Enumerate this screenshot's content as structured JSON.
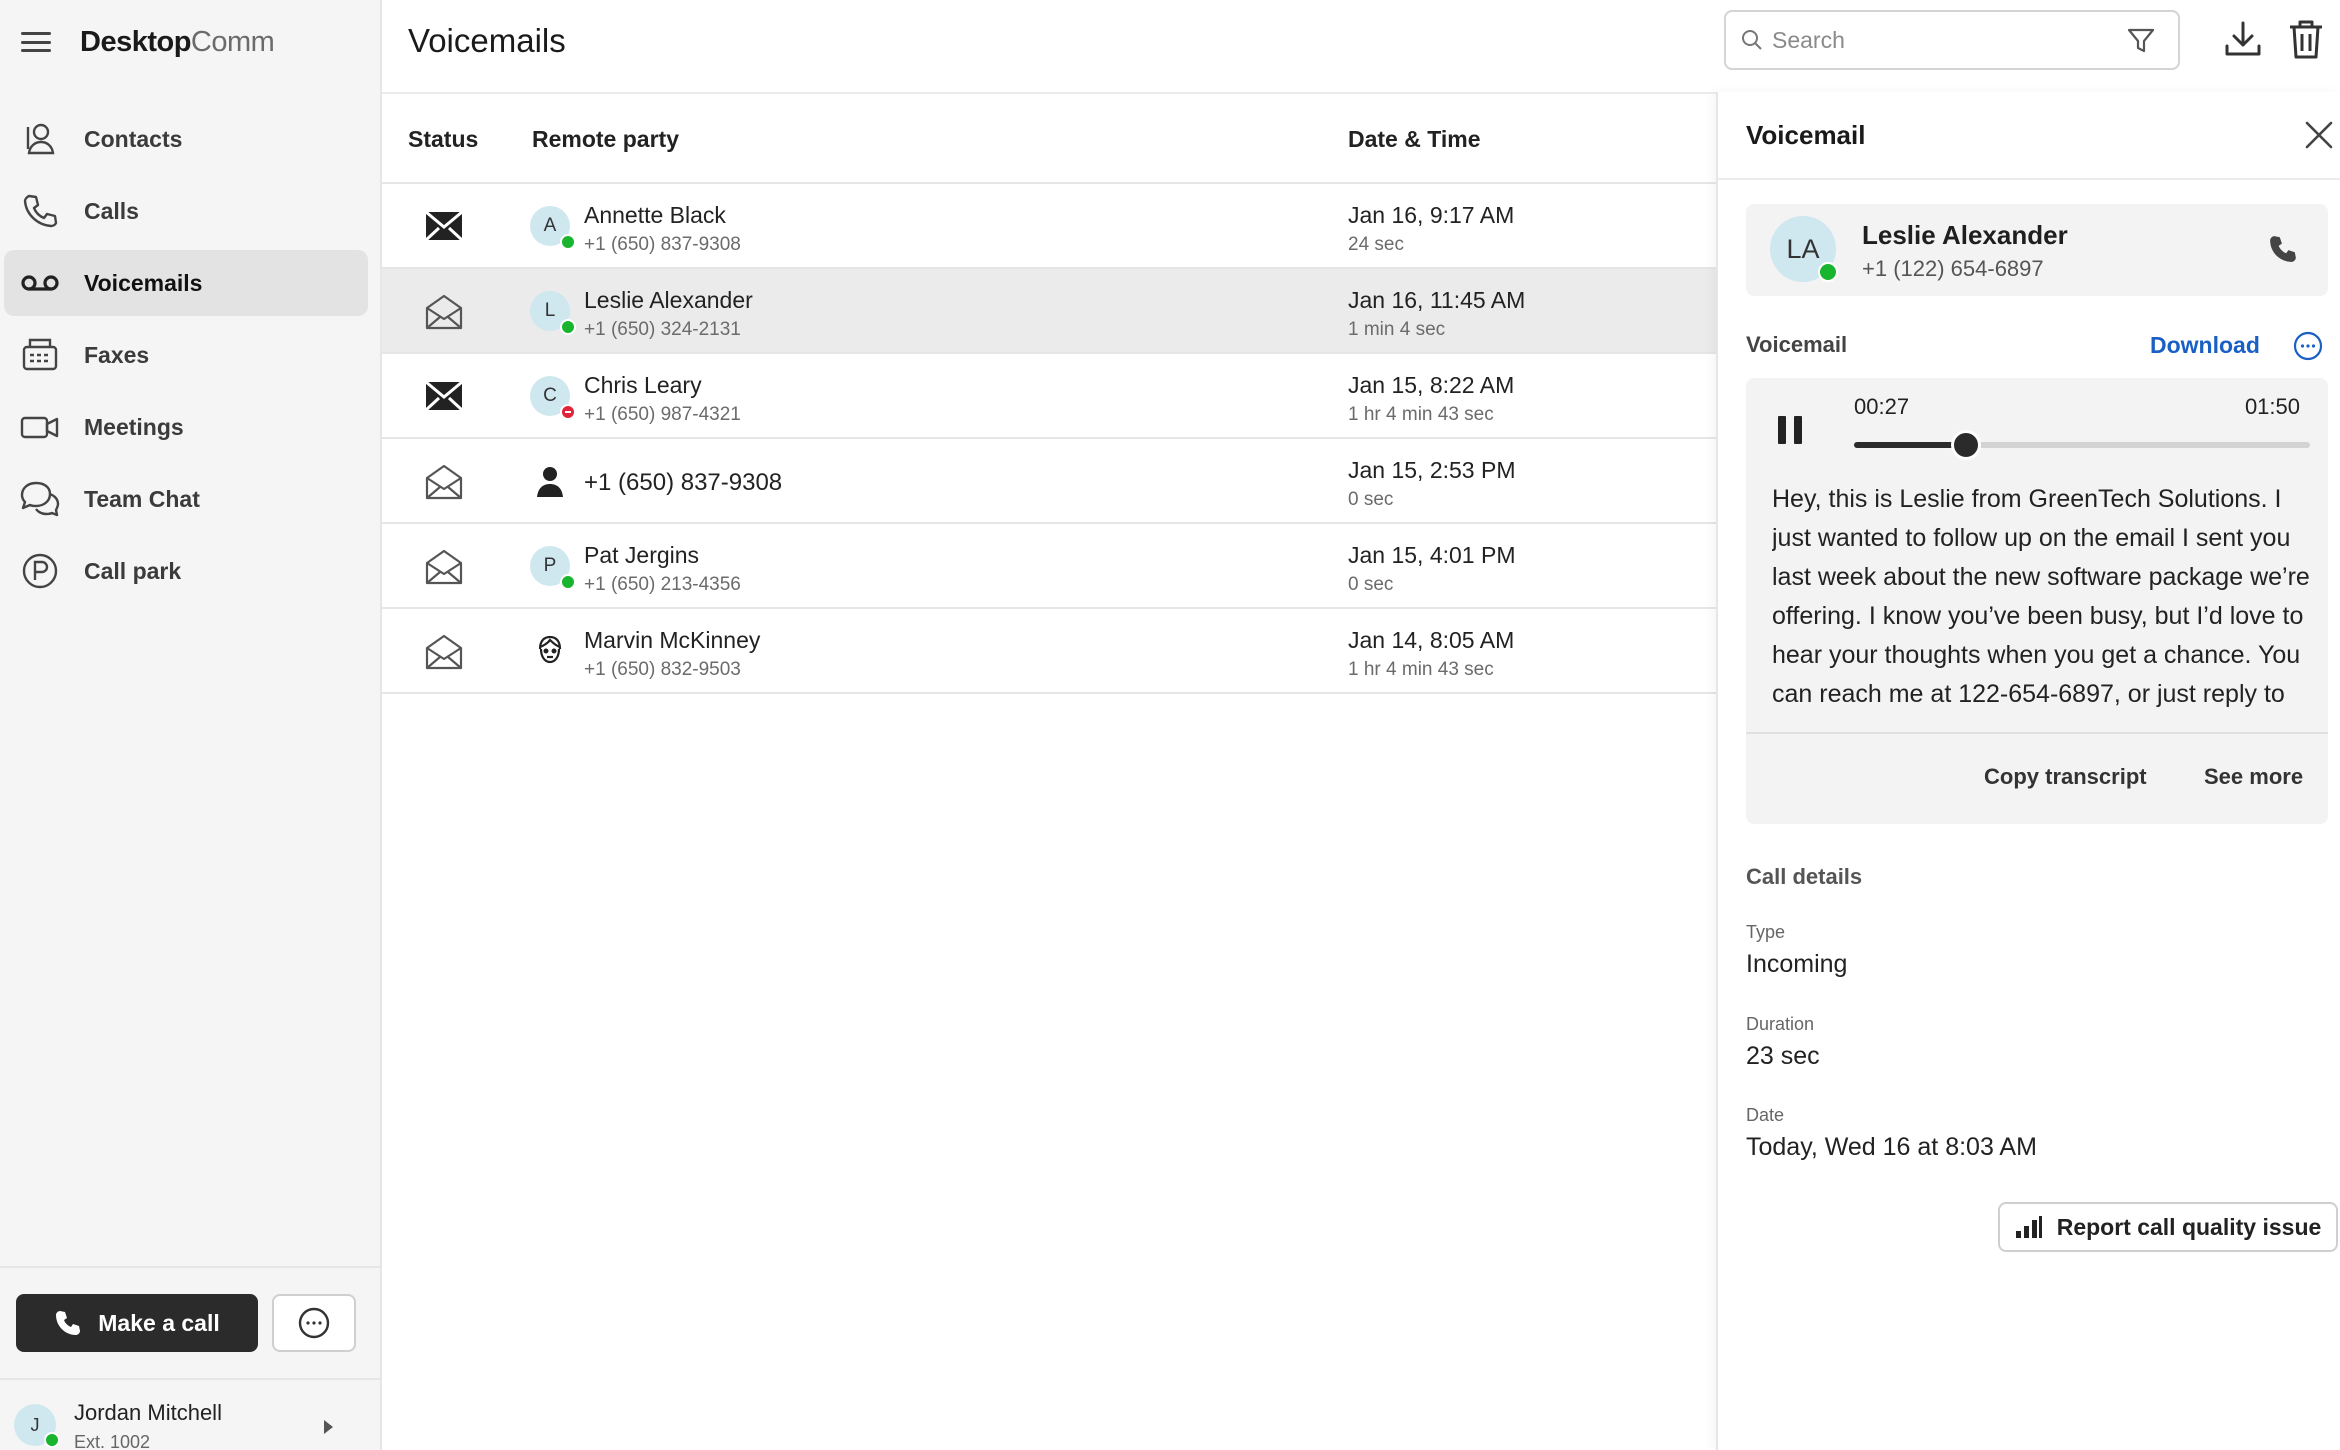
{
  "brand": {
    "bold": "Desktop",
    "light": "Comm"
  },
  "nav": [
    {
      "label": "Contacts",
      "icon": "contacts-icon"
    },
    {
      "label": "Calls",
      "icon": "phone-icon"
    },
    {
      "label": "Voicemails",
      "icon": "voicemail-icon",
      "active": true
    },
    {
      "label": "Faxes",
      "icon": "fax-icon"
    },
    {
      "label": "Meetings",
      "icon": "video-icon"
    },
    {
      "label": "Team Chat",
      "icon": "chat-icon"
    },
    {
      "label": "Call park",
      "icon": "park-icon"
    }
  ],
  "actions": {
    "make_call": "Make a call"
  },
  "user": {
    "initial": "J",
    "name": "Jordan Mitchell",
    "ext": "Ext. 1002",
    "presence": "available"
  },
  "header": {
    "title": "Voicemails",
    "search_placeholder": "Search"
  },
  "table": {
    "columns": {
      "status": "Status",
      "party": "Remote party",
      "datetime": "Date & Time"
    },
    "rows": [
      {
        "read": false,
        "initial": "A",
        "name": "Annette Black",
        "phone": "+1 (650) 837-9308",
        "date": "Jan 16, 9:17 AM",
        "duration": "24 sec",
        "presence": "available"
      },
      {
        "read": true,
        "initial": "L",
        "name": "Leslie Alexander",
        "phone": "+1 (650) 324-2131",
        "date": "Jan 16, 11:45 AM",
        "duration": "1 min 4 sec",
        "presence": "available",
        "selected": true
      },
      {
        "read": false,
        "initial": "C",
        "name": "Chris Leary",
        "phone": "+1 (650) 987-4321",
        "date": "Jan 15, 8:22 AM",
        "duration": "1 hr 4 min 43 sec",
        "presence": "dnd"
      },
      {
        "read": true,
        "initial": "",
        "name": "+1 (650) 837-9308",
        "phone": "",
        "date": "Jan 15, 2:53 PM",
        "duration": "0 sec",
        "presence": "unknown"
      },
      {
        "read": true,
        "initial": "P",
        "name": "Pat Jergins",
        "phone": "+1 (650) 213-4356",
        "date": "Jan 15, 4:01 PM",
        "duration": "0 sec",
        "presence": "available"
      },
      {
        "read": true,
        "initial": "",
        "name": "Marvin McKinney",
        "phone": "+1 (650) 832-9503",
        "date": "Jan 14, 8:05 AM",
        "duration": "1 hr 4 min 43 sec",
        "presence": "photo"
      }
    ]
  },
  "panel": {
    "title": "Voicemail",
    "contact": {
      "initials": "LA",
      "name": "Leslie Alexander",
      "phone": "+1 (122) 654-6897"
    },
    "voicemail_label": "Voicemail",
    "download": "Download",
    "player": {
      "current": "00:27",
      "total": "01:50",
      "progress": 0.245
    },
    "transcript": "Hey, this is Leslie from GreenTech Solutions. I just wanted to follow up on the email I sent you last week about the new software package we’re offering. I know you’ve been busy, but I’d love to hear your thoughts when you get a chance. You can reach me at 122-654-6897, or just reply to the email if",
    "copy_transcript": "Copy transcript",
    "see_more": "See more",
    "details": {
      "title": "Call details",
      "type_label": "Type",
      "type": "Incoming",
      "duration_label": "Duration",
      "duration": "23 sec",
      "date_label": "Date",
      "date": "Today, Wed 16 at 8:03 AM"
    },
    "report": "Report call quality issue"
  },
  "colors": {
    "accent": "#1a5fc4",
    "available": "#1ab52e",
    "dnd": "#e0243a",
    "dark_button": "#2b2b2b"
  }
}
